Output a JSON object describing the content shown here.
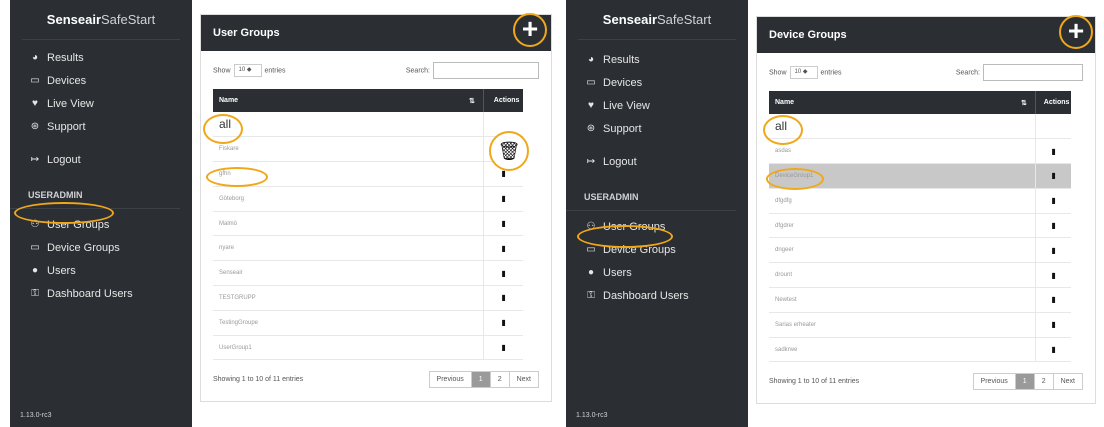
{
  "brand": {
    "bold": "Senseair",
    "light": "SafeStart"
  },
  "nav": {
    "results": "Results",
    "devices": "Devices",
    "live_view": "Live View",
    "support": "Support",
    "logout": "Logout",
    "section": "USERADMIN",
    "user_groups": "User Groups",
    "device_groups": "Device Groups",
    "users": "Users",
    "dashboard_users": "Dashboard Users"
  },
  "version": "1.13.0-rc3",
  "icons": {
    "results": "dashboard-icon",
    "devices": "monitor-icon",
    "live_view": "heartbeat-icon",
    "support": "life-ring-icon",
    "logout": "sign-out-icon",
    "user_groups": "users-icon",
    "device_groups": "monitor-icon",
    "users": "user-icon",
    "dashboard_users": "key-icon",
    "add": "plus-icon",
    "delete": "trash-icon"
  },
  "accent": "#f0a81a",
  "left": {
    "title": "User Groups",
    "show": "Show",
    "entries_value": "10",
    "entries": "entries",
    "search": "Search:",
    "col_name": "Name",
    "col_actions": "Actions",
    "rows": [
      "all",
      "Fiskare",
      "gfhn",
      "Göteborg",
      "Malmö",
      "nyare",
      "Senseair",
      "TESTGRUPP",
      "TestingGroupe",
      "UserGroup1"
    ],
    "info": "Showing 1 to 10 of 11 entries",
    "prev": "Previous",
    "page1": "1",
    "page2": "2",
    "next": "Next"
  },
  "right": {
    "title": "Device Groups",
    "show": "Show",
    "entries_value": "10",
    "entries": "entries",
    "search": "Search:",
    "col_name": "Name",
    "col_actions": "Actions",
    "rows": [
      "all",
      "asdas",
      "DeviceGroup1",
      "dfgdfg",
      "dfgdrer",
      "dngeer",
      "drount",
      "Newtest",
      "Sarias erheater",
      "sadkrwe"
    ],
    "info": "Showing 1 to 10 of 11 entries",
    "prev": "Previous",
    "page1": "1",
    "page2": "2",
    "next": "Next"
  }
}
